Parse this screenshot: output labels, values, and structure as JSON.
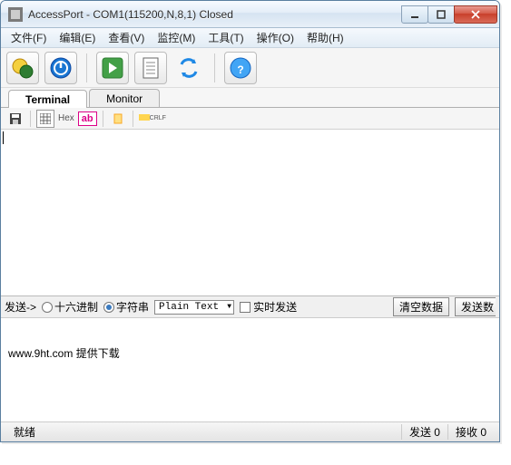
{
  "titlebar": {
    "text": "AccessPort - COM1(115200,N,8,1) Closed"
  },
  "menu": {
    "file": "文件(F)",
    "edit": "编辑(E)",
    "view": "查看(V)",
    "monitor": "监控(M)",
    "tools": "工具(T)",
    "operation": "操作(O)",
    "help": "帮助(H)"
  },
  "tabs": {
    "terminal": "Terminal",
    "monitor": "Monitor"
  },
  "subtoolbar": {
    "hex": "Hex",
    "ab": "ab",
    "crlf": "CRLF"
  },
  "sendbar": {
    "label": "发送->",
    "hex_radio": "十六进制",
    "str_radio": "字符串",
    "format_selected": "Plain Text",
    "realtime": "实时发送",
    "clear": "清空数据",
    "send": "发送数"
  },
  "bottom_text": "www.9ht.com 提供下载",
  "status": {
    "ready": "就绪",
    "tx": "发送 0",
    "rx": "接收 0"
  }
}
